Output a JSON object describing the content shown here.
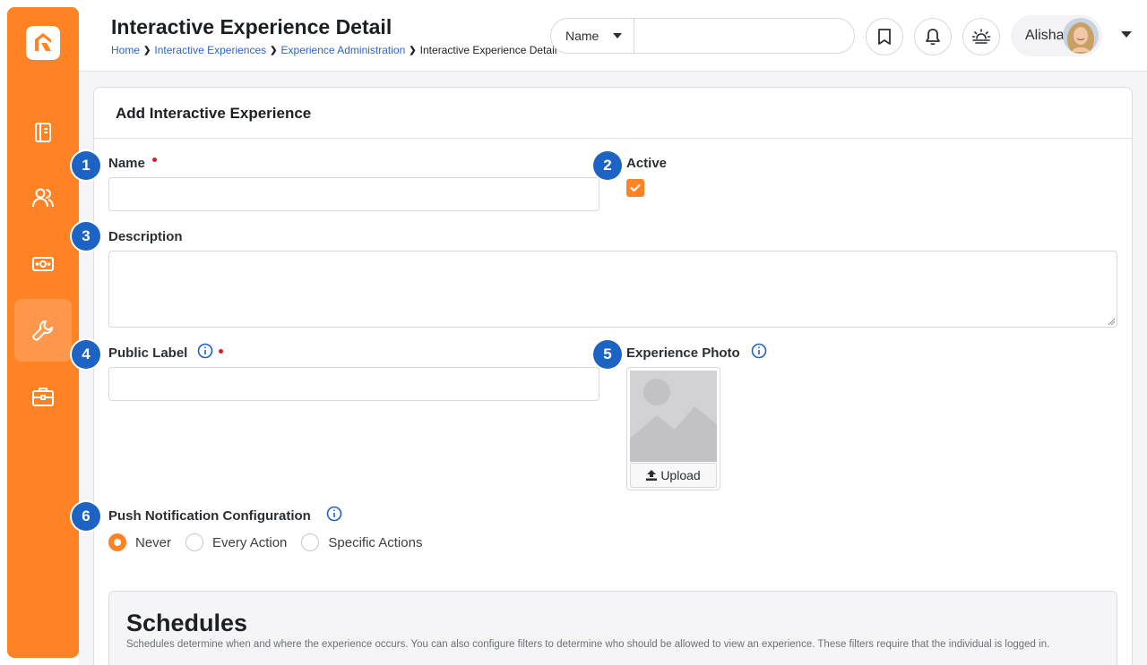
{
  "header": {
    "title": "Interactive Experience Detail",
    "breadcrumb": [
      "Home",
      "Interactive Experiences",
      "Experience Administration",
      "Interactive Experience Detail"
    ],
    "search": {
      "filter_value": "Name",
      "value": "",
      "placeholder": ""
    },
    "user_name": "Alisha"
  },
  "sidebar": {
    "items": [
      {
        "icon": "book-icon"
      },
      {
        "icon": "people-icon"
      },
      {
        "icon": "money-icon"
      },
      {
        "icon": "wrench-icon",
        "active": true
      },
      {
        "icon": "briefcase-icon"
      }
    ]
  },
  "form": {
    "card_title": "Add Interactive Experience",
    "name_label": "Name",
    "name_value": "",
    "active_label": "Active",
    "active_checked": true,
    "description_label": "Description",
    "description_value": "",
    "public_label_label": "Public Label",
    "public_label_value": "",
    "experience_photo_label": "Experience Photo",
    "upload_label": "Upload",
    "push_label": "Push Notification Configuration",
    "push_options": [
      "Never",
      "Every Action",
      "Specific Actions"
    ],
    "push_selected": "Never"
  },
  "annotations": [
    "1",
    "2",
    "3",
    "4",
    "5",
    "6"
  ],
  "schedules": {
    "title": "Schedules",
    "description": "Schedules determine when and where the experience occurs. You can also configure filters to determine who should be allowed to view an experience. These filters require that the individual is logged in."
  },
  "colors": {
    "accent": "#ff8225",
    "badge": "#1d63c4",
    "link": "#2a66c8",
    "required": "#d4202a"
  }
}
